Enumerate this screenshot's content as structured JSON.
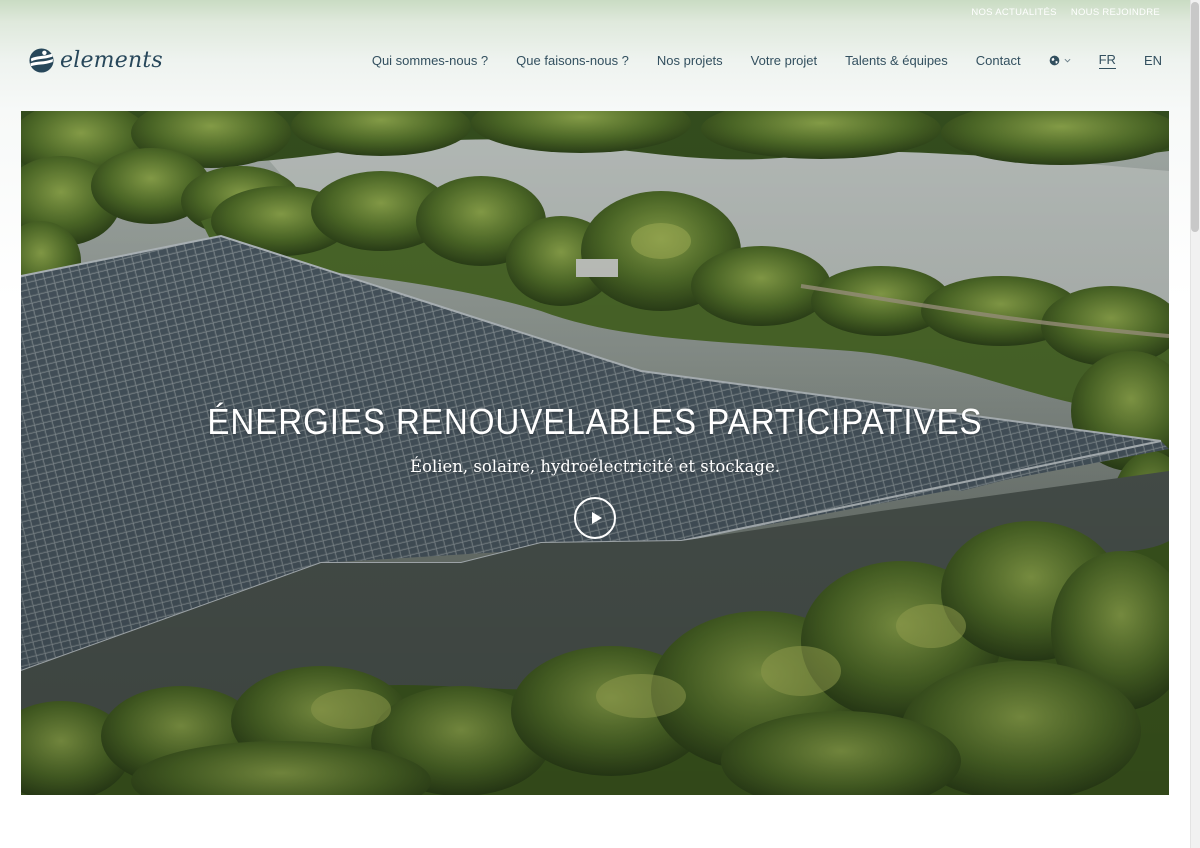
{
  "topbar": {
    "news": "NOS ACTUALITÉS",
    "join": "NOUS REJOINDRE"
  },
  "logo": {
    "text": "elements",
    "icon": "earth-logo-icon",
    "color": "#27475a"
  },
  "nav": {
    "items": [
      "Qui sommes-nous ?",
      "Que faisons-nous ?",
      "Nos projets",
      "Votre projet",
      "Talents & équipes",
      "Contact"
    ],
    "globe_icon": "globe-icon",
    "languages": [
      {
        "label": "FR",
        "active": true
      },
      {
        "label": "EN",
        "active": false
      }
    ]
  },
  "hero": {
    "title": "ÉNERGIES RENOUVELABLES PARTICIPATIVES",
    "subtitle": "Éolien, solaire, hydroélectricité et stockage.",
    "play_icon": "play-icon"
  },
  "colors": {
    "text": "#33505f",
    "water": "#7e8c84",
    "foliage": "#5a7a2e"
  }
}
